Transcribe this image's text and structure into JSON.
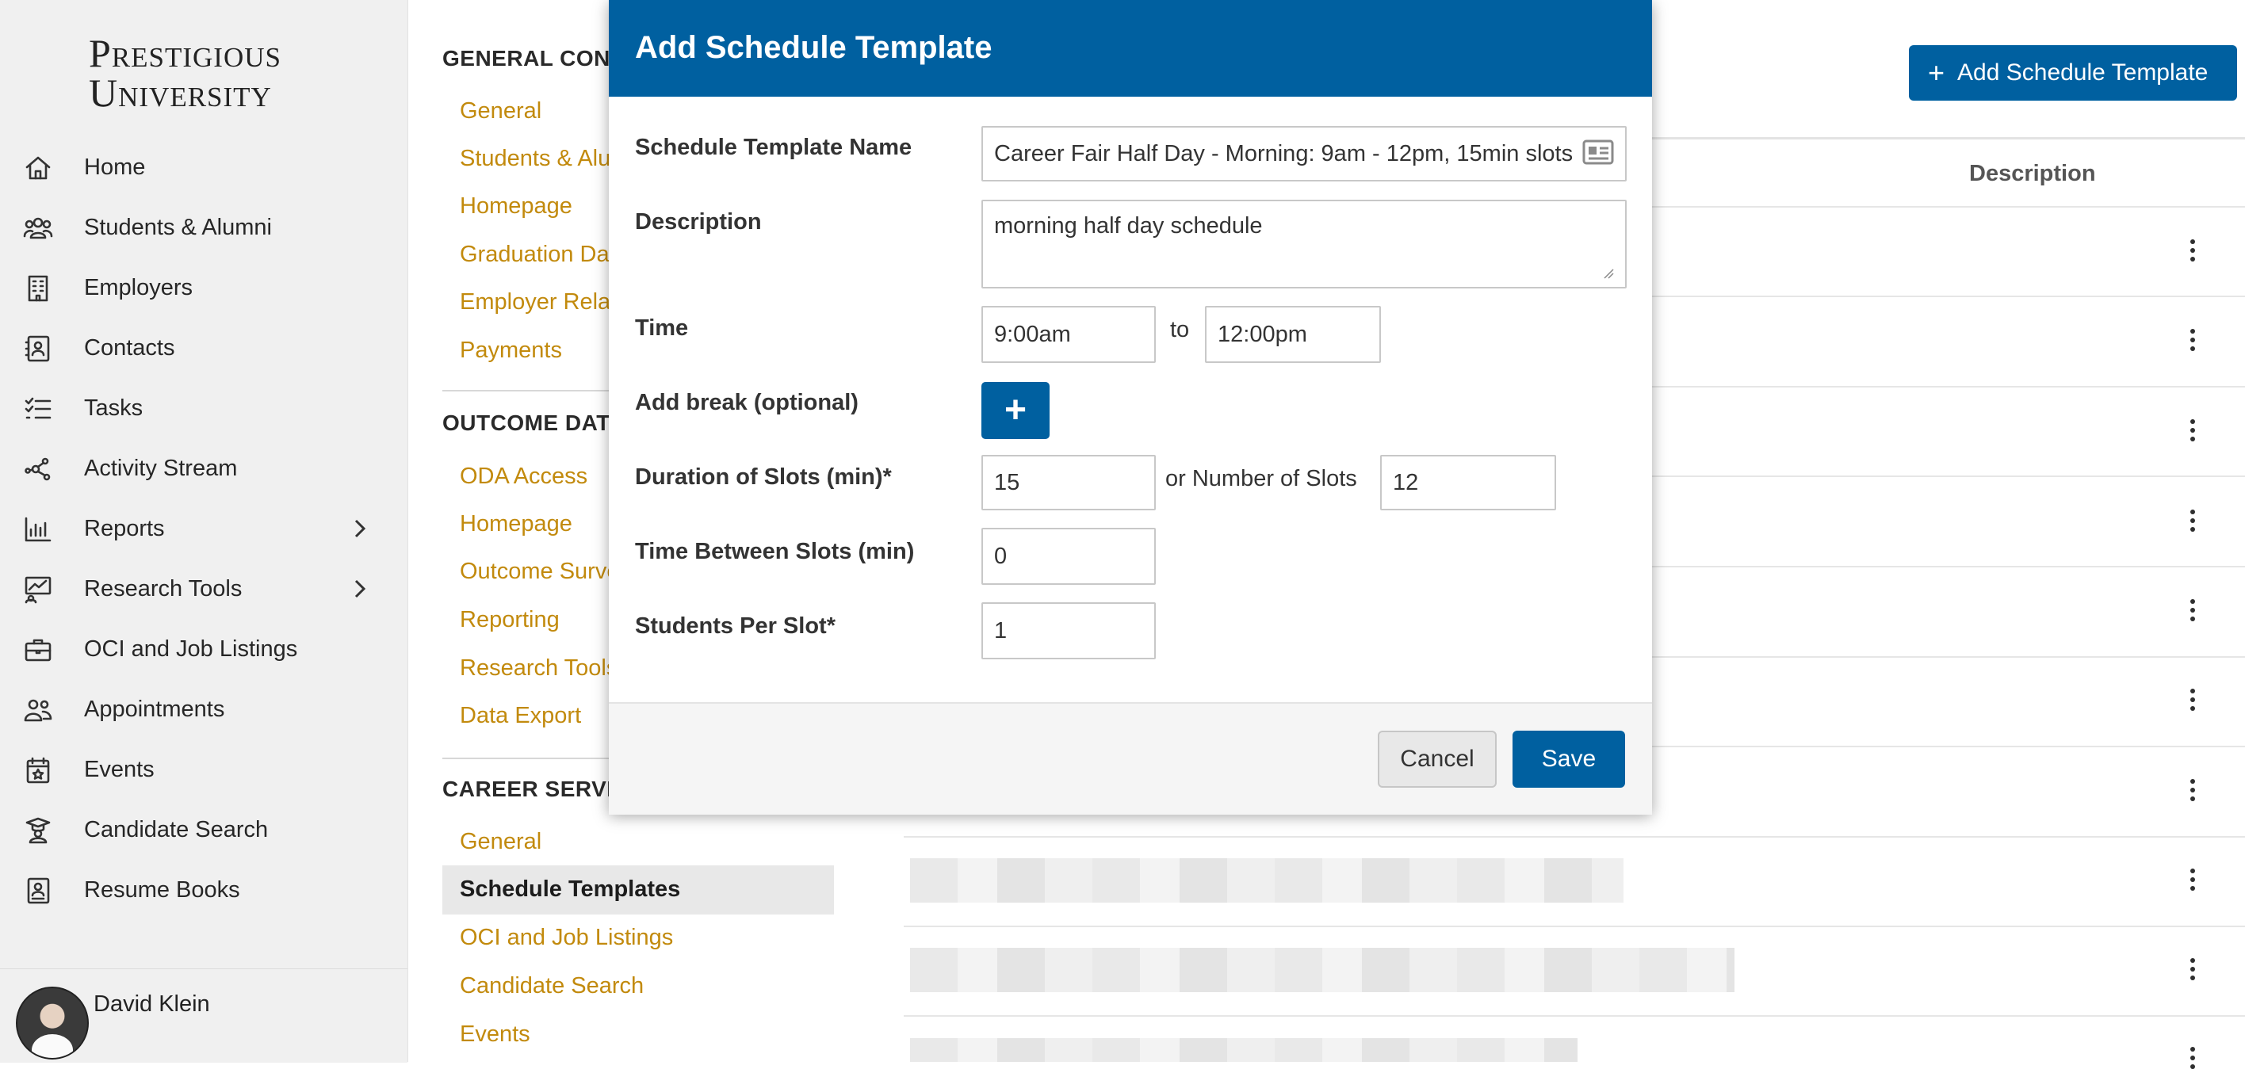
{
  "logo": {
    "line1": "Prestigious",
    "line2": "University"
  },
  "nav": [
    {
      "label": "Home",
      "icon": "home-icon"
    },
    {
      "label": "Students & Alumni",
      "icon": "users-icon"
    },
    {
      "label": "Employers",
      "icon": "building-icon"
    },
    {
      "label": "Contacts",
      "icon": "contact-card-icon"
    },
    {
      "label": "Tasks",
      "icon": "task-list-icon"
    },
    {
      "label": "Activity Stream",
      "icon": "network-icon"
    },
    {
      "label": "Reports",
      "icon": "bar-chart-icon",
      "has_submenu": true
    },
    {
      "label": "Research Tools",
      "icon": "research-chart-icon",
      "has_submenu": true
    },
    {
      "label": "OCI and Job Listings",
      "icon": "briefcase-icon"
    },
    {
      "label": "Appointments",
      "icon": "people-icon"
    },
    {
      "label": "Events",
      "icon": "calendar-star-icon"
    },
    {
      "label": "Candidate Search",
      "icon": "graduate-icon"
    },
    {
      "label": "Resume Books",
      "icon": "resume-book-icon"
    }
  ],
  "user": {
    "name": "David Klein"
  },
  "submenu": {
    "general_config": {
      "title": "GENERAL CONFIGURATION",
      "links": [
        "General",
        "Students & Alumni",
        "Homepage",
        "Graduation Dates",
        "Employer Relations",
        "Payments"
      ]
    },
    "outcome_data": {
      "title": "OUTCOME DATA",
      "links": [
        "ODA Access",
        "Homepage",
        "Outcome Surveys",
        "Reporting",
        "Research Tools",
        "Data Export"
      ]
    },
    "career_services": {
      "title": "CAREER SERVICES",
      "links": [
        "General",
        "Schedule Templates",
        "OCI and Job Listings",
        "Candidate Search",
        "Events"
      ],
      "active": "Schedule Templates"
    }
  },
  "main": {
    "add_button_label": "Add Schedule Template",
    "columns": {
      "description": "Description"
    }
  },
  "modal": {
    "title": "Add Schedule Template",
    "fields": {
      "name": {
        "label": "Schedule Template Name",
        "value": "Career Fair Half Day - Morning: 9am - 12pm, 15min slots"
      },
      "description": {
        "label": "Description",
        "value": "morning half day schedule"
      },
      "time": {
        "label": "Time",
        "start": "9:00am",
        "to": "to",
        "end": "12:00pm"
      },
      "add_break": {
        "label": "Add break (optional)",
        "button": "+"
      },
      "duration": {
        "label": "Duration of Slots (min)*",
        "value": "15",
        "or_label": "or Number of Slots",
        "num_slots": "12"
      },
      "between": {
        "label": "Time Between Slots (min)",
        "value": "0"
      },
      "students": {
        "label": "Students Per Slot*",
        "value": "1"
      }
    },
    "cancel_label": "Cancel",
    "save_label": "Save"
  },
  "colors": {
    "primary": "#0060a0",
    "link": "#c28a0d",
    "sidebar_bg": "#f0f0f0"
  }
}
